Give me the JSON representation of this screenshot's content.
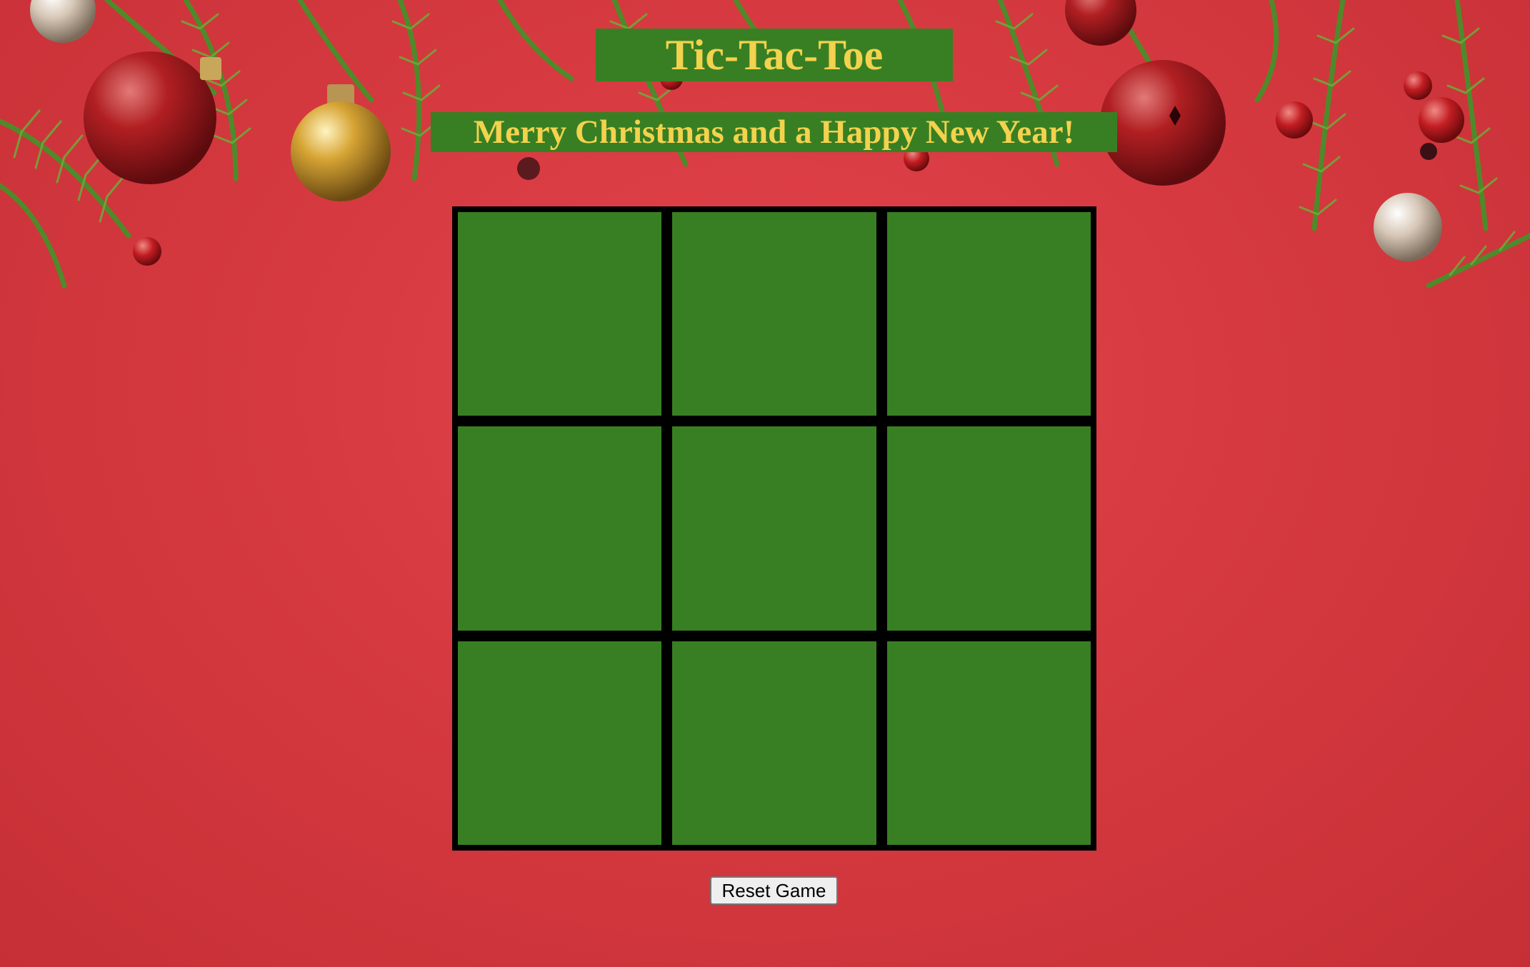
{
  "header": {
    "title": "Tic-Tac-Toe",
    "subtitle": "Merry Christmas and a Happy New Year!"
  },
  "board": {
    "cells": [
      "",
      "",
      "",
      "",
      "",
      "",
      "",
      "",
      ""
    ]
  },
  "controls": {
    "reset_label": "Reset Game"
  },
  "colors": {
    "background": "#d63a40",
    "tile_green": "#387f23",
    "text_gold": "#f3d24e",
    "grid_lines": "#000000"
  },
  "decorations": [
    "pine-branches",
    "red-glitter-ornament",
    "gold-ornament",
    "red-jingle-bell",
    "silver-ornament",
    "red-berries"
  ]
}
